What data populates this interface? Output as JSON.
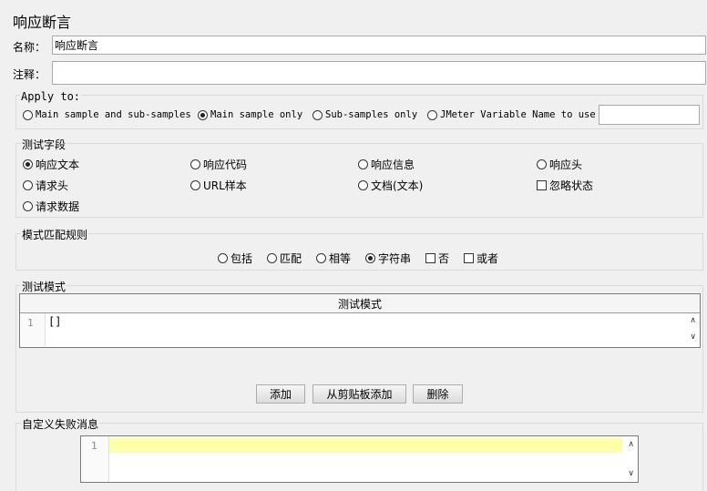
{
  "title": "响应断言",
  "name": {
    "label": "名称：",
    "value": "响应断言"
  },
  "comment": {
    "label": "注释：",
    "value": ""
  },
  "apply_to": {
    "label": "Apply to:",
    "options": [
      "Main sample and sub-samples",
      "Main sample only",
      "Sub-samples only",
      "JMeter Variable Name to use"
    ],
    "selected": 1,
    "variable_value": ""
  },
  "test_field": {
    "label": "测试字段",
    "options": [
      {
        "label": "响应文本",
        "selected": true,
        "type": "radio"
      },
      {
        "label": "响应代码",
        "selected": false,
        "type": "radio"
      },
      {
        "label": "响应信息",
        "selected": false,
        "type": "radio"
      },
      {
        "label": "响应头",
        "selected": false,
        "type": "radio"
      },
      {
        "label": "请求头",
        "selected": false,
        "type": "radio"
      },
      {
        "label": "URL样本",
        "selected": false,
        "type": "radio"
      },
      {
        "label": "文档(文本)",
        "selected": false,
        "type": "radio"
      },
      {
        "label": "忽略状态",
        "selected": false,
        "type": "checkbox"
      },
      {
        "label": "请求数据",
        "selected": false,
        "type": "radio"
      }
    ]
  },
  "pattern_rules": {
    "label": "模式匹配规则",
    "options": [
      {
        "label": "包括",
        "type": "radio",
        "selected": false
      },
      {
        "label": "匹配",
        "type": "radio",
        "selected": false
      },
      {
        "label": "相等",
        "type": "radio",
        "selected": false
      },
      {
        "label": "字符串",
        "type": "radio",
        "selected": true
      },
      {
        "label": "否",
        "type": "checkbox",
        "selected": false
      },
      {
        "label": "或者",
        "type": "checkbox",
        "selected": false
      }
    ]
  },
  "test_patterns": {
    "label": "测试模式",
    "column_header": "测试模式",
    "rows": [
      {
        "line": "1",
        "text": "[]"
      }
    ],
    "buttons": [
      "添加",
      "从剪贴板添加",
      "删除"
    ]
  },
  "custom_failure": {
    "label": "自定义失败消息",
    "line": "1"
  }
}
